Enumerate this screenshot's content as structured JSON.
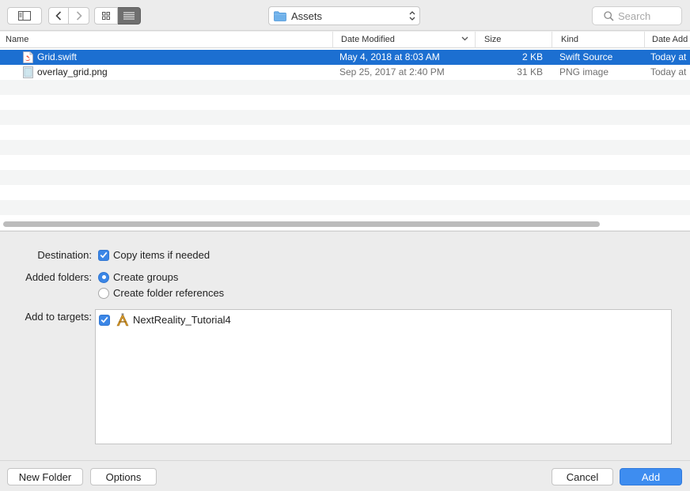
{
  "toolbar": {
    "path_popup_label": "Assets",
    "search_placeholder": "Search"
  },
  "columns": {
    "name": "Name",
    "date_modified": "Date Modified",
    "size": "Size",
    "kind": "Kind",
    "date_added": "Date Add"
  },
  "files": [
    {
      "name": "Grid.swift",
      "date_modified": "May 4, 2018 at 8:03 AM",
      "size": "2 KB",
      "kind": "Swift Source",
      "date_added": "Today at",
      "icon": "swift-file-icon",
      "selected": true
    },
    {
      "name": "overlay_grid.png",
      "date_modified": "Sep 25, 2017 at 2:40 PM",
      "size": "31 KB",
      "kind": "PNG image",
      "date_added": "Today at",
      "icon": "png-file-icon",
      "selected": false
    }
  ],
  "options": {
    "destination_label": "Destination:",
    "copy_items_label": "Copy items if needed",
    "copy_items_checked": true,
    "added_folders_label": "Added folders:",
    "create_groups_label": "Create groups",
    "create_folder_refs_label": "Create folder references",
    "selected_folder_option": "create_groups",
    "add_to_targets_label": "Add to targets:",
    "targets": [
      {
        "name": "NextReality_Tutorial4",
        "checked": true,
        "icon": "xcode-app-icon"
      }
    ]
  },
  "buttons": {
    "new_folder": "New Folder",
    "options": "Options",
    "cancel": "Cancel",
    "add": "Add"
  },
  "colors": {
    "selection": "#1c6fd1",
    "accent": "#3e8df0"
  }
}
